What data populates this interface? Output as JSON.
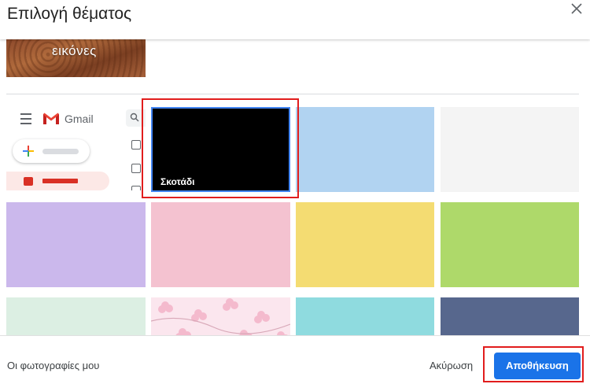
{
  "dialog": {
    "title": "Επιλογή θέματος"
  },
  "photo_banner": {
    "text": "εικόνες"
  },
  "preview": {
    "gmail_label": "Gmail"
  },
  "themes": [
    {
      "name": "dark",
      "label": "Σκοτάδι",
      "color": "#000000",
      "selected": true
    },
    {
      "name": "light-blue",
      "color": "#b1d3f1"
    },
    {
      "name": "light-gray",
      "color": "#f4f4f4"
    },
    {
      "name": "lavender",
      "color": "#cbb8ec"
    },
    {
      "name": "pink",
      "color": "#f4c2d0"
    },
    {
      "name": "yellow",
      "color": "#f4dc72"
    },
    {
      "name": "green",
      "color": "#aed96a"
    },
    {
      "name": "mint",
      "color": "#dcefe3"
    },
    {
      "name": "cherry-blossom",
      "color": "#fbe6ee"
    },
    {
      "name": "turquoise",
      "color": "#8fdbdf"
    },
    {
      "name": "slate-blue",
      "color": "#57678d"
    }
  ],
  "footer": {
    "my_photos": "Οι φωτογραφίες μου",
    "cancel": "Ακύρωση",
    "save": "Αποθήκευση"
  },
  "colors": {
    "accent": "#1a73e8",
    "highlight": "#e11d1d",
    "selection": "#4285f4"
  }
}
